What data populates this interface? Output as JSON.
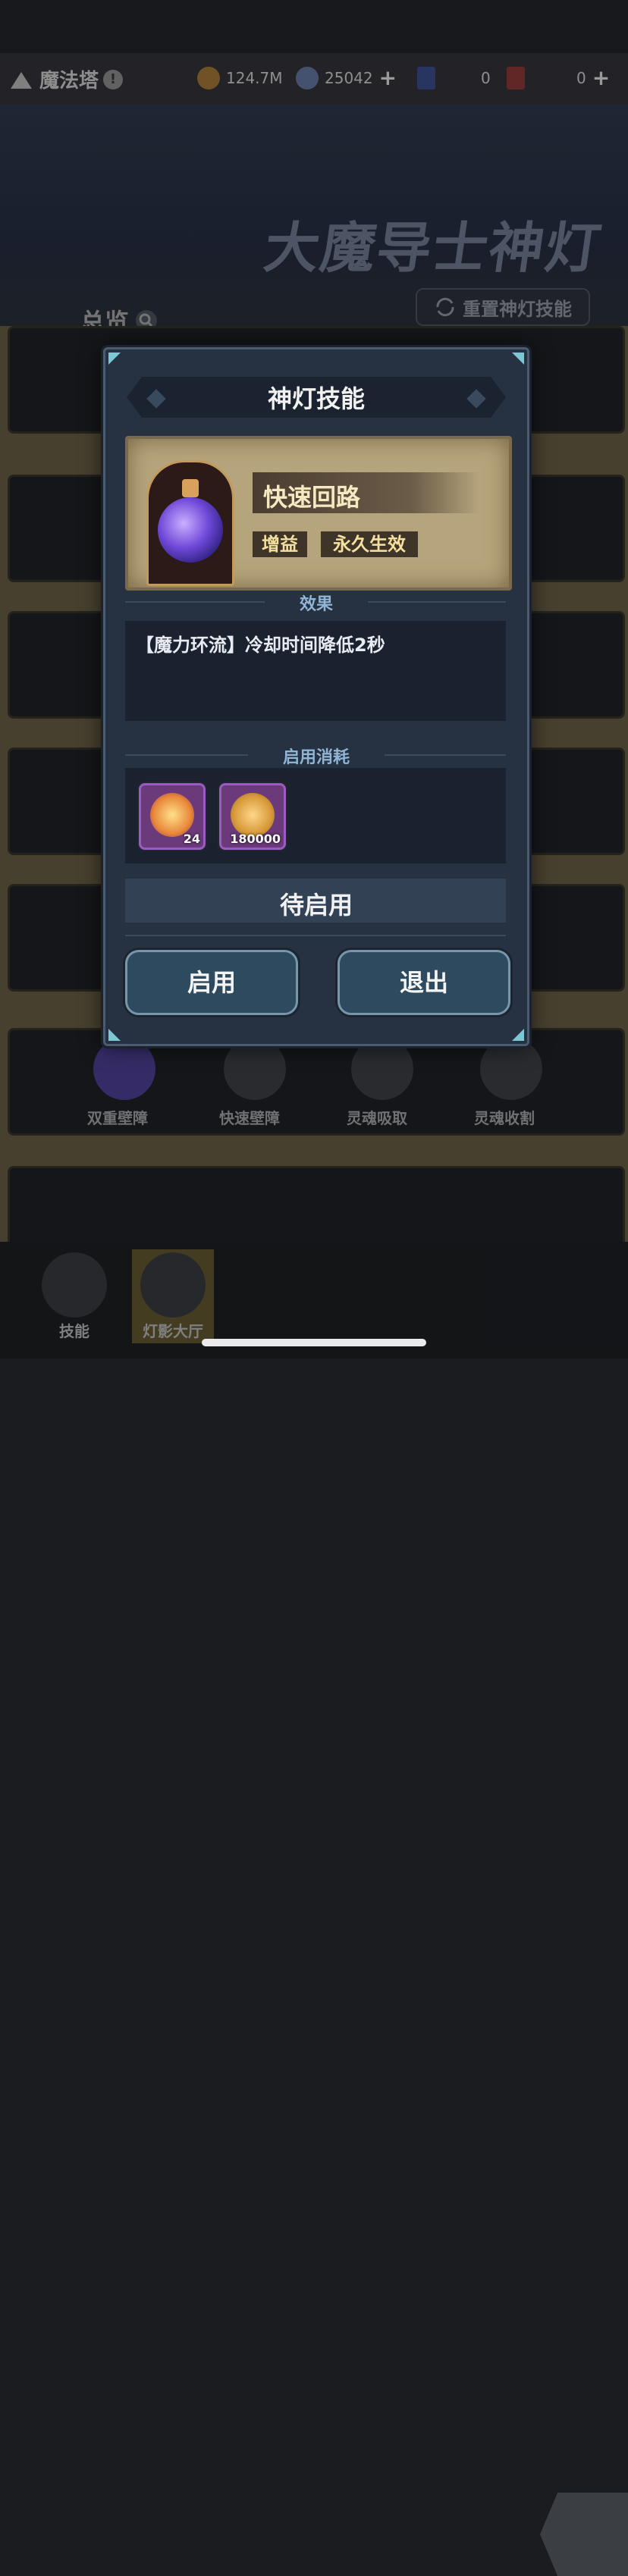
{
  "header": {
    "title": "魔法塔",
    "info_icon": "!",
    "resources": [
      {
        "icon": "gold-coin-icon",
        "value": "124.7M"
      },
      {
        "icon": "crystal-icon",
        "value": "25042",
        "plus": "+"
      },
      {
        "icon": "blue-card-icon",
        "value": "0"
      },
      {
        "icon": "red-card-icon",
        "value": "0",
        "plus": "+"
      }
    ]
  },
  "banner": {
    "title": "大魔导士神灯",
    "overview_label": "总览",
    "reset_label": "重置神灯技能"
  },
  "background_skills": [
    "双重壁障",
    "快速壁障",
    "灵魂吸取",
    "灵魂收割"
  ],
  "bottom_nav": [
    {
      "label": "技能"
    },
    {
      "label": "灯影大厅"
    }
  ],
  "dialog": {
    "title": "神灯技能",
    "skill_name": "快速回路",
    "tags": [
      "增益",
      "永久生效"
    ],
    "effect_label": "效果",
    "effect_text": "【魔力环流】冷却时间降低2秒",
    "cost_label": "启用消耗",
    "costs": [
      {
        "icon": "flame-spirit-icon",
        "count": "24"
      },
      {
        "icon": "gold-medal-icon",
        "count": "180000"
      }
    ],
    "status": "待启用",
    "enable_button": "启用",
    "exit_button": "退出"
  },
  "colors": {
    "dialog_bg": "#263141",
    "card_bg": "#b6a57c",
    "accent_label": "#8fb4d4",
    "item_border": "#9a5cc2"
  }
}
